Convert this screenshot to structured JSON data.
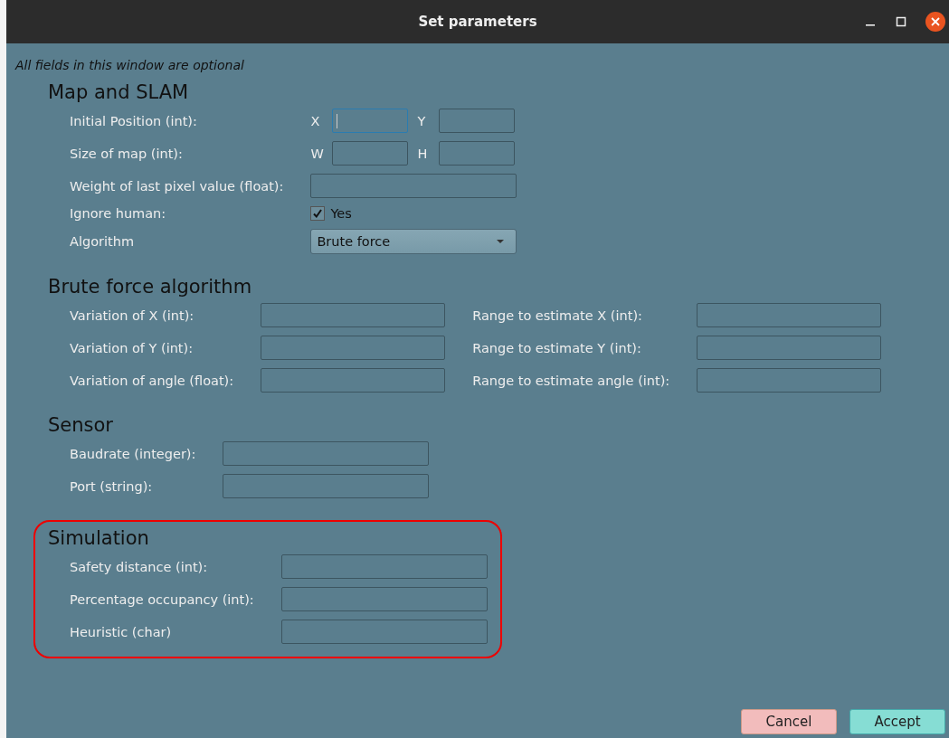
{
  "window": {
    "title": "Set parameters"
  },
  "note": "All fields in this window are optional",
  "sections": [
    {
      "title": "Map and SLAM",
      "kind": "form",
      "highlighted": false,
      "rows": [
        {
          "kind": "pair",
          "label": "Initial Position (int):",
          "fields": [
            {
              "prefix": "X",
              "focused": true
            },
            {
              "prefix": "Y",
              "focused": false
            }
          ]
        },
        {
          "kind": "pair",
          "label": "Size of map (int):",
          "fields": [
            {
              "prefix": "W",
              "focused": false
            },
            {
              "prefix": "H",
              "focused": false
            }
          ]
        },
        {
          "kind": "field",
          "label": "Weight of last pixel value (float):"
        },
        {
          "kind": "checkbox",
          "label": "Ignore human:",
          "option": "Yes",
          "checked": true
        },
        {
          "kind": "dropdown",
          "label": "Algorithm",
          "value": "Brute force"
        }
      ]
    },
    {
      "title": "Brute force algorithm",
      "kind": "two-column",
      "highlighted": false,
      "rows": [
        {
          "kind": "field",
          "label": "Variation of X (int):"
        },
        {
          "kind": "field",
          "label": "Range to estimate X (int):"
        },
        {
          "kind": "field",
          "label": "Variation of Y (int):"
        },
        {
          "kind": "field",
          "label": "Range to estimate Y (int):"
        },
        {
          "kind": "field",
          "label": "Variation of angle (float):"
        },
        {
          "kind": "field",
          "label": "Range to estimate angle (int):"
        }
      ]
    },
    {
      "title": "Sensor",
      "kind": "form",
      "highlighted": false,
      "rows": [
        {
          "kind": "field",
          "label": "Baudrate (integer):"
        },
        {
          "kind": "field",
          "label": "Port (string):"
        }
      ]
    },
    {
      "title": "Simulation",
      "kind": "form",
      "highlighted": true,
      "rows": [
        {
          "kind": "field",
          "label": "Safety distance (int):"
        },
        {
          "kind": "field",
          "label": "Percentage occupancy (int):"
        },
        {
          "kind": "field",
          "label": "Heuristic (char)"
        }
      ]
    }
  ],
  "buttons": [
    {
      "label": "Cancel",
      "kind": "cancel"
    },
    {
      "label": "Accept",
      "kind": "accept"
    }
  ]
}
